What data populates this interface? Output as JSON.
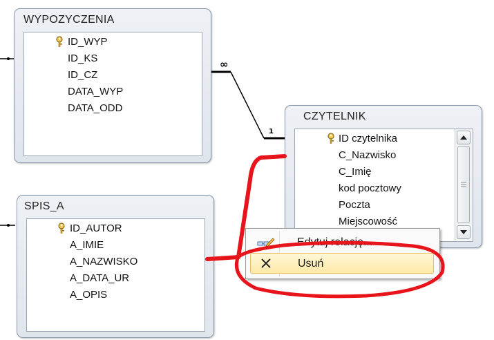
{
  "tables": {
    "wypozyczenia": {
      "title": "WYPOZYCZENIA",
      "fields": [
        "ID_WYP",
        "ID_KS",
        "ID_CZ",
        "DATA_WYP",
        "DATA_ODD"
      ]
    },
    "czytelnik": {
      "title": "CZYTELNIK",
      "fields": [
        "ID czytelnika",
        "C_Nazwisko",
        "C_Imię",
        "kod pocztowy",
        "Poczta",
        "Miejscowość"
      ]
    },
    "spis_a": {
      "title": "SPIS_A",
      "fields": [
        "ID_AUTOR",
        "A_IMIE",
        "A_NAZWISKO",
        "A_DATA_UR",
        "A_OPIS"
      ]
    }
  },
  "relationship": {
    "many_label": "∞",
    "one_label": "1"
  },
  "context_menu": {
    "items": [
      {
        "label": "Edytuj relację...",
        "icon": "edit-relationship-icon"
      },
      {
        "label": "Usuń",
        "icon": "delete-x-icon"
      }
    ]
  },
  "colors": {
    "annotation_red": "#e8141c",
    "menu_highlight": "#ffe9a8"
  }
}
